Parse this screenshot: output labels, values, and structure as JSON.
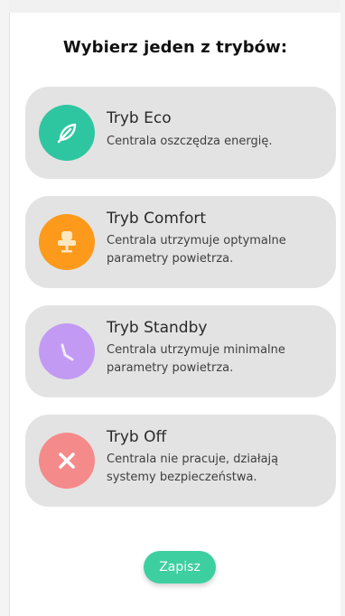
{
  "dialog": {
    "title": "Wybierz jeden z trybów:"
  },
  "modes": [
    {
      "name": "Tryb Eco",
      "description": "Centrala oszczędza energię.",
      "icon": "leaf-icon",
      "color": "#2ec6a0"
    },
    {
      "name": "Tryb Comfort",
      "description": "Centrala utrzymuje optymalne parametry powietrza.",
      "icon": "armchair-icon",
      "color": "#fd9a1c"
    },
    {
      "name": "Tryb Standby",
      "description": "Centrala utrzymuje minimalne parametry powietrza.",
      "icon": "clock-icon",
      "color": "#c29af4"
    },
    {
      "name": "Tryb Off",
      "description": "Centrala nie pracuje, działają systemy bezpieczeństwa.",
      "icon": "close-icon",
      "color": "#f58a8a"
    }
  ],
  "actions": {
    "save_label": "Zapisz",
    "save_color": "#3ecfa1"
  }
}
